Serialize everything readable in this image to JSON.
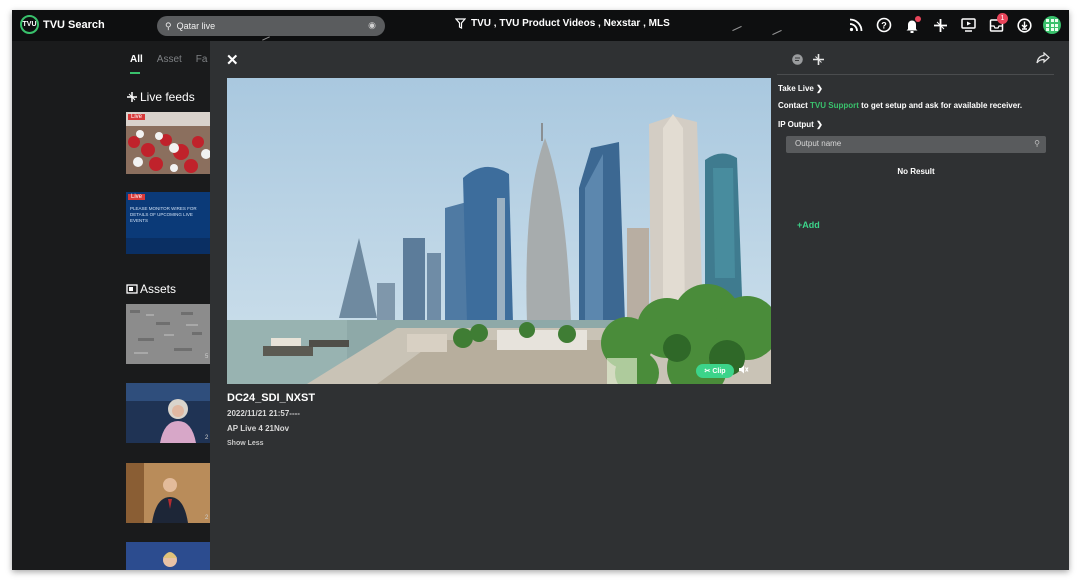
{
  "app": {
    "logo_badge": "TVU",
    "title": "TVU Search"
  },
  "search": {
    "value": "Qatar live",
    "placeholder": ""
  },
  "filter": {
    "label": "TVU , TVU Product Videos , Nexstar , MLS"
  },
  "header_icons": [
    "rss-icon",
    "help-icon",
    "notification-bell-icon",
    "transmit-icon",
    "monitor-play-icon",
    "inbox-icon",
    "download-icon",
    "apps-grid-icon"
  ],
  "notifications": {
    "inbox_badge": "1"
  },
  "colors": {
    "accent": "#39c16c",
    "clip": "#3cd48a",
    "alert": "#e8455a",
    "panel": "#2f3133",
    "topbar": "#0e0f10"
  },
  "tabs": [
    {
      "label": "All"
    },
    {
      "label": "Asset"
    },
    {
      "label": "Fa"
    }
  ],
  "sections": {
    "live_feeds": "Live feeds",
    "assets": "Assets"
  },
  "live_feeds": [
    {
      "badge": "Live",
      "caption": ""
    },
    {
      "badge": "Live",
      "caption": "PLEASE MONITOR WIRES FOR DETAILS OF UPCOMING LIVE EVENTS"
    }
  ],
  "assets_side_labels": [
    "5",
    "2",
    "2"
  ],
  "player": {
    "title": "DC24_SDI_NXST",
    "datetime": "2022/11/21 21:57----",
    "description": "AP Live 4 21Nov",
    "show_less": "Show Less",
    "clip_label": "Clip"
  },
  "right_panel": {
    "take_live": "Take Live",
    "contact_prefix": "Contact",
    "contact_link": "TVU Support",
    "contact_suffix": "to get setup and ask for available receiver.",
    "ip_output": "IP Output",
    "output_search_placeholder": "Output name",
    "no_result": "No Result",
    "add_label": "+Add"
  }
}
